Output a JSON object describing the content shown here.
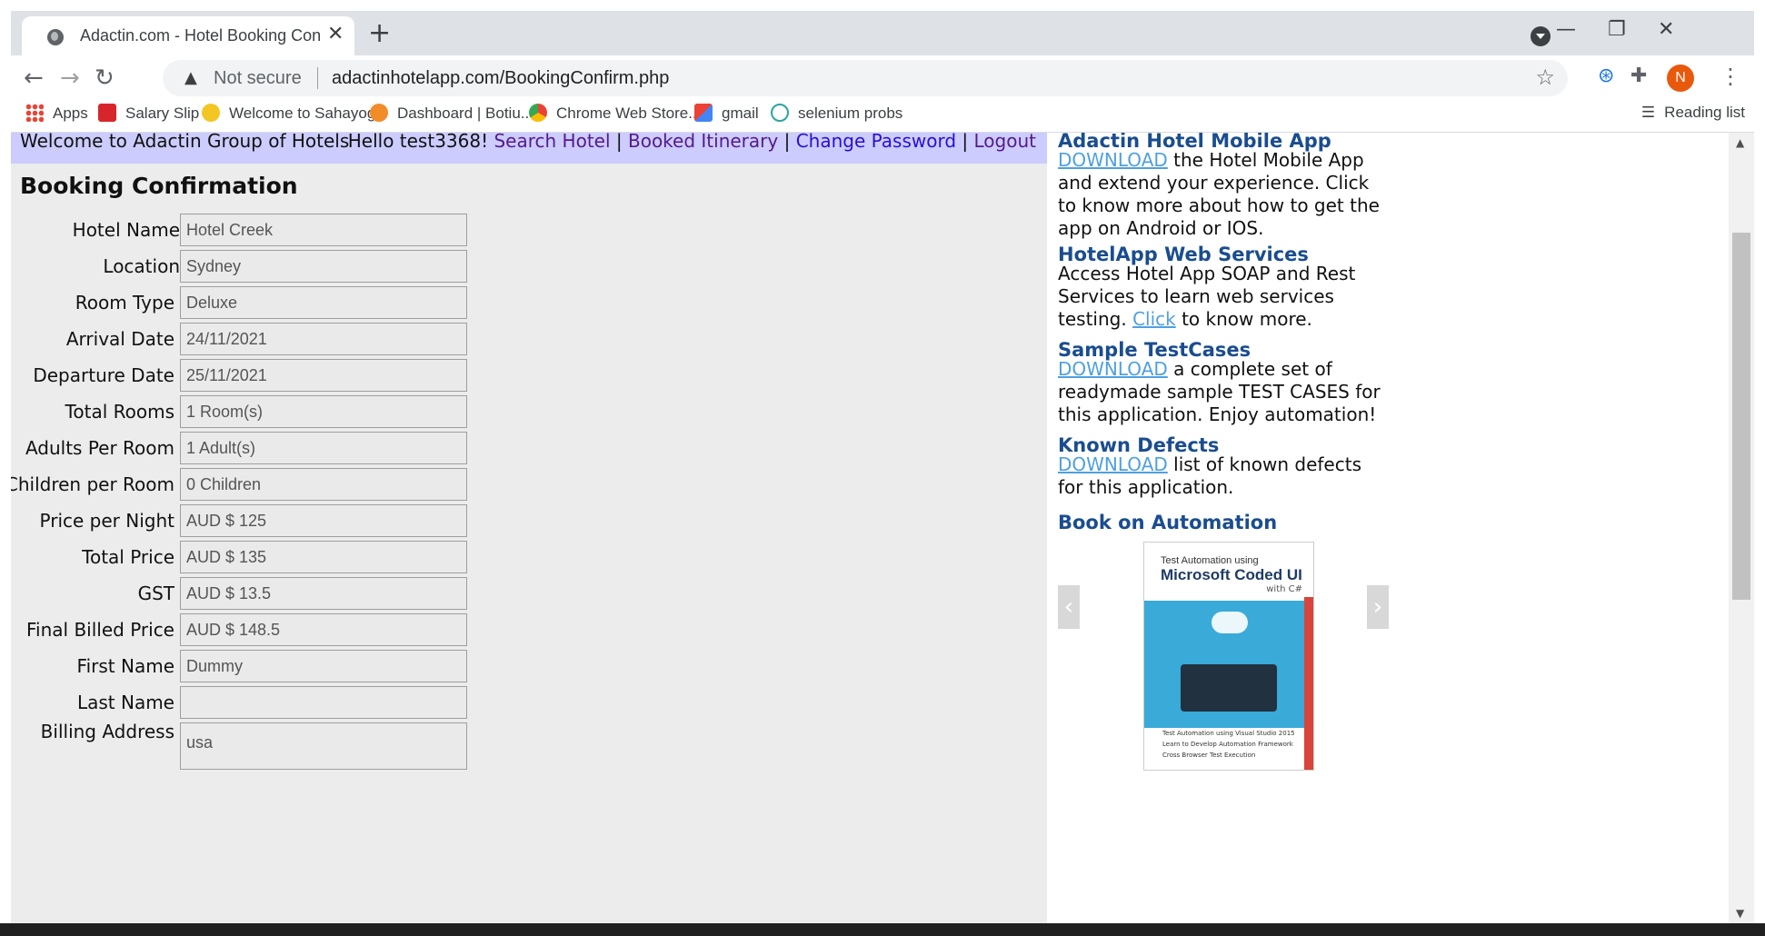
{
  "browser": {
    "tab_title": "Adactin.com - Hotel Booking Con",
    "new_tab": "+",
    "address": {
      "security": "Not secure",
      "url": "adactinhotelapp.com/BookingConfirm.php"
    },
    "profile_initial": "N",
    "bookmarks": [
      "Apps",
      "Salary Slip",
      "Welcome to Sahayog",
      "Dashboard | Botiu...",
      "Chrome Web Store...",
      "gmail",
      "selenium probs"
    ],
    "reading_list": "Reading list"
  },
  "header": {
    "welcome": "Welcome to Adactin Group of Hotels",
    "greeting": "Hello test3368!",
    "links": [
      "Search Hotel",
      "Booked Itinerary",
      "Change Password",
      "Logout"
    ],
    "sep": "|"
  },
  "booking": {
    "title": "Booking Confirmation",
    "fields": [
      {
        "label": "Hotel Name",
        "value": "Hotel Creek"
      },
      {
        "label": "Location",
        "value": "Sydney"
      },
      {
        "label": "Room Type",
        "value": "Deluxe"
      },
      {
        "label": "Arrival Date",
        "value": "24/11/2021"
      },
      {
        "label": "Departure Date",
        "value": "25/11/2021"
      },
      {
        "label": "Total Rooms",
        "value": "1 Room(s)"
      },
      {
        "label": "Adults Per Room",
        "value": "1 Adult(s)"
      },
      {
        "label": "Children per Room",
        "value": "0 Children"
      },
      {
        "label": "Price per Night",
        "value": "AUD $ 125"
      },
      {
        "label": "Total Price",
        "value": "AUD $ 135"
      },
      {
        "label": "GST",
        "value": "AUD $ 13.5"
      },
      {
        "label": "Final Billed Price",
        "value": "AUD $ 148.5"
      },
      {
        "label": "First Name",
        "value": "Dummy"
      },
      {
        "label": "Last Name",
        "value": ""
      },
      {
        "label": "Billing Address",
        "value": "usa"
      }
    ]
  },
  "sidebar": {
    "mobile": {
      "title": "Adactin Hotel Mobile App",
      "link": "DOWNLOAD",
      "text": " the Hotel Mobile App and extend your experience. Click to know more about how to get the app on Android or IOS."
    },
    "webservices": {
      "title": "HotelApp Web Services",
      "text1": "Access Hotel App SOAP and Rest Services to learn web services testing. ",
      "link": "Click",
      "text2": " to know more."
    },
    "testcases": {
      "title": "Sample TestCases",
      "link": "DOWNLOAD",
      "text": " a complete set of readymade sample TEST CASES for this application. Enjoy automation!"
    },
    "defects": {
      "title": "Known Defects",
      "link": "DOWNLOAD",
      "text": " list of known defects for this application."
    },
    "book": {
      "title": "Book on Automation",
      "cover_line1": "Test Automation using",
      "cover_line2": "Microsoft Coded UI",
      "cover_line3": "with C#",
      "bullets": [
        "Test Automation using Visual Studio 2015",
        "Learn to Develop Automation Framework",
        "Cross Browser Test Execution"
      ]
    }
  }
}
